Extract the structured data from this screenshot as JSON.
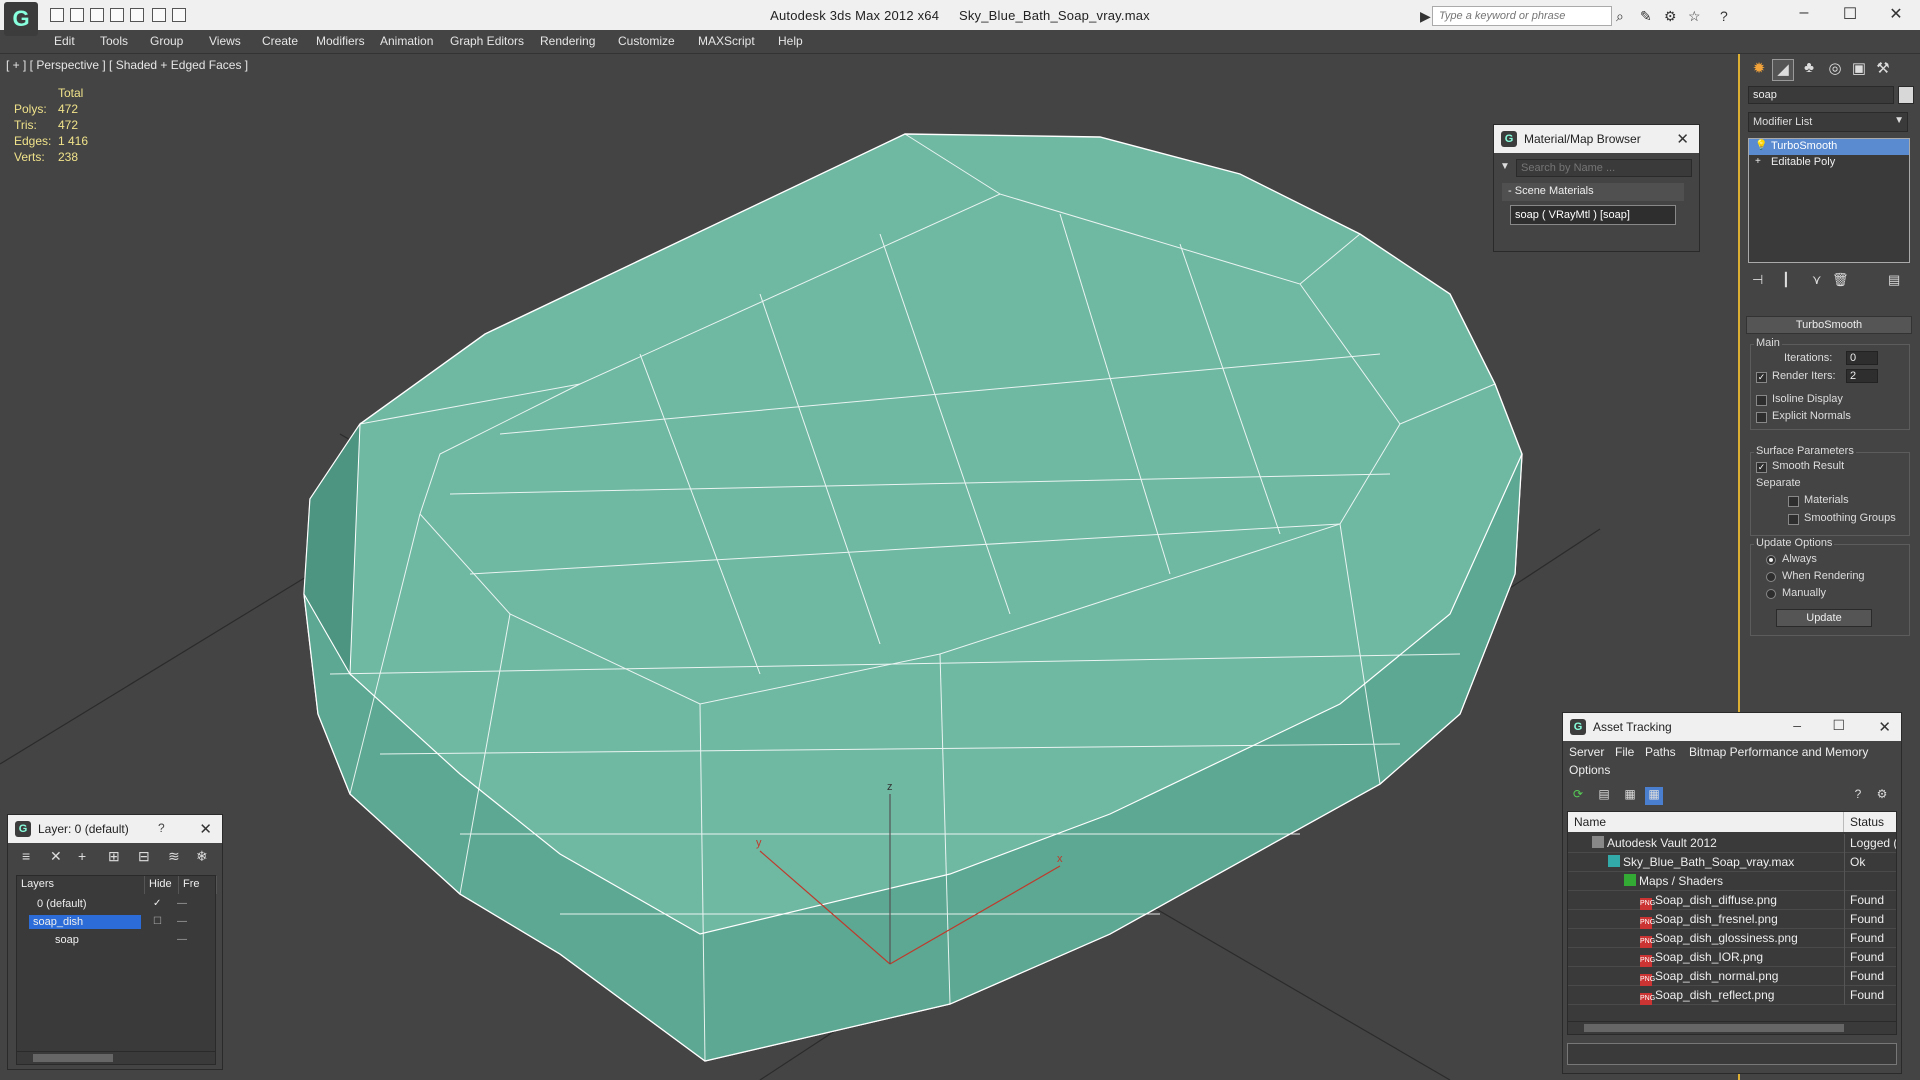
{
  "titlebar": {
    "app_title": "Autodesk 3ds Max  2012 x64",
    "file_name": "Sky_Blue_Bath_Soap_vray.max",
    "search_placeholder": "Type a keyword or phrase",
    "logo_glyph": "G"
  },
  "menu": [
    "Edit",
    "Tools",
    "Group",
    "Views",
    "Create",
    "Modifiers",
    "Animation",
    "Graph Editors",
    "Rendering",
    "Customize",
    "MAXScript",
    "Help"
  ],
  "viewport": {
    "label": "[ + ] [ Perspective ] [ Shaded + Edged Faces ]",
    "stats_header": "Total",
    "stats": [
      {
        "label": "Polys:",
        "value": "472"
      },
      {
        "label": "Tris:",
        "value": "472"
      },
      {
        "label": "Edges:",
        "value": "1 416"
      },
      {
        "label": "Verts:",
        "value": "238"
      }
    ],
    "gizmo": {
      "x": "x",
      "y": "y",
      "z": "z"
    },
    "colors": {
      "background": "#444444",
      "mesh_fill": "#6fb8a2",
      "mesh_edge": "#ffffff",
      "grid": "#2a2a2a",
      "axis": "#c0392b"
    }
  },
  "material_browser": {
    "title": "Material/Map Browser",
    "search_placeholder": "Search by Name ...",
    "section": "Scene Materials",
    "item": "soap  ( VRayMtl )  [soap]"
  },
  "command_panel": {
    "object_name": "soap",
    "modifier_list": "Modifier List",
    "stack": [
      {
        "label": "TurboSmooth",
        "selected": true
      },
      {
        "label": "Editable Poly",
        "selected": false
      }
    ],
    "rollout": "TurboSmooth",
    "main_group": "Main",
    "iterations_label": "Iterations:",
    "iterations_value": "0",
    "render_iters_label": "Render Iters:",
    "render_iters_value": "2",
    "isoline_label": "Isoline Display",
    "explicit_label": "Explicit Normals",
    "surface_group": "Surface Parameters",
    "smooth_result_label": "Smooth Result",
    "separate_label": "Separate",
    "materials_label": "Materials",
    "smoothing_label": "Smoothing Groups",
    "update_group": "Update Options",
    "always_label": "Always",
    "when_rendering_label": "When Rendering",
    "manually_label": "Manually",
    "update_button": "Update"
  },
  "layer_manager": {
    "title": "Layer: 0 (default)",
    "help": "?",
    "col_layers": "Layers",
    "col_hide": "Hide",
    "col_freeze": "Fre",
    "rows": [
      {
        "name": "0 (default)",
        "selected": false
      },
      {
        "name": "soap_dish",
        "selected": true
      },
      {
        "name": "soap",
        "selected": false
      }
    ]
  },
  "asset_tracking": {
    "title": "Asset Tracking",
    "menu": [
      "Server",
      "File",
      "Paths",
      "Bitmap Performance and Memory",
      "Options"
    ],
    "col_name": "Name",
    "col_status": "Status",
    "rows": [
      {
        "name": "Autodesk Vault 2012",
        "status": "Logged (",
        "icon": "vault"
      },
      {
        "name": "Sky_Blue_Bath_Soap_vray.max",
        "status": "Ok",
        "icon": "max"
      },
      {
        "name": "Maps / Shaders",
        "status": "",
        "icon": "folder"
      },
      {
        "name": "Soap_dish_diffuse.png",
        "status": "Found",
        "icon": "png"
      },
      {
        "name": "Soap_dish_fresnel.png",
        "status": "Found",
        "icon": "png"
      },
      {
        "name": "Soap_dish_glossiness.png",
        "status": "Found",
        "icon": "png"
      },
      {
        "name": "Soap_dish_IOR.png",
        "status": "Found",
        "icon": "png"
      },
      {
        "name": "Soap_dish_normal.png",
        "status": "Found",
        "icon": "png"
      },
      {
        "name": "Soap_dish_reflect.png",
        "status": "Found",
        "icon": "png"
      }
    ]
  }
}
